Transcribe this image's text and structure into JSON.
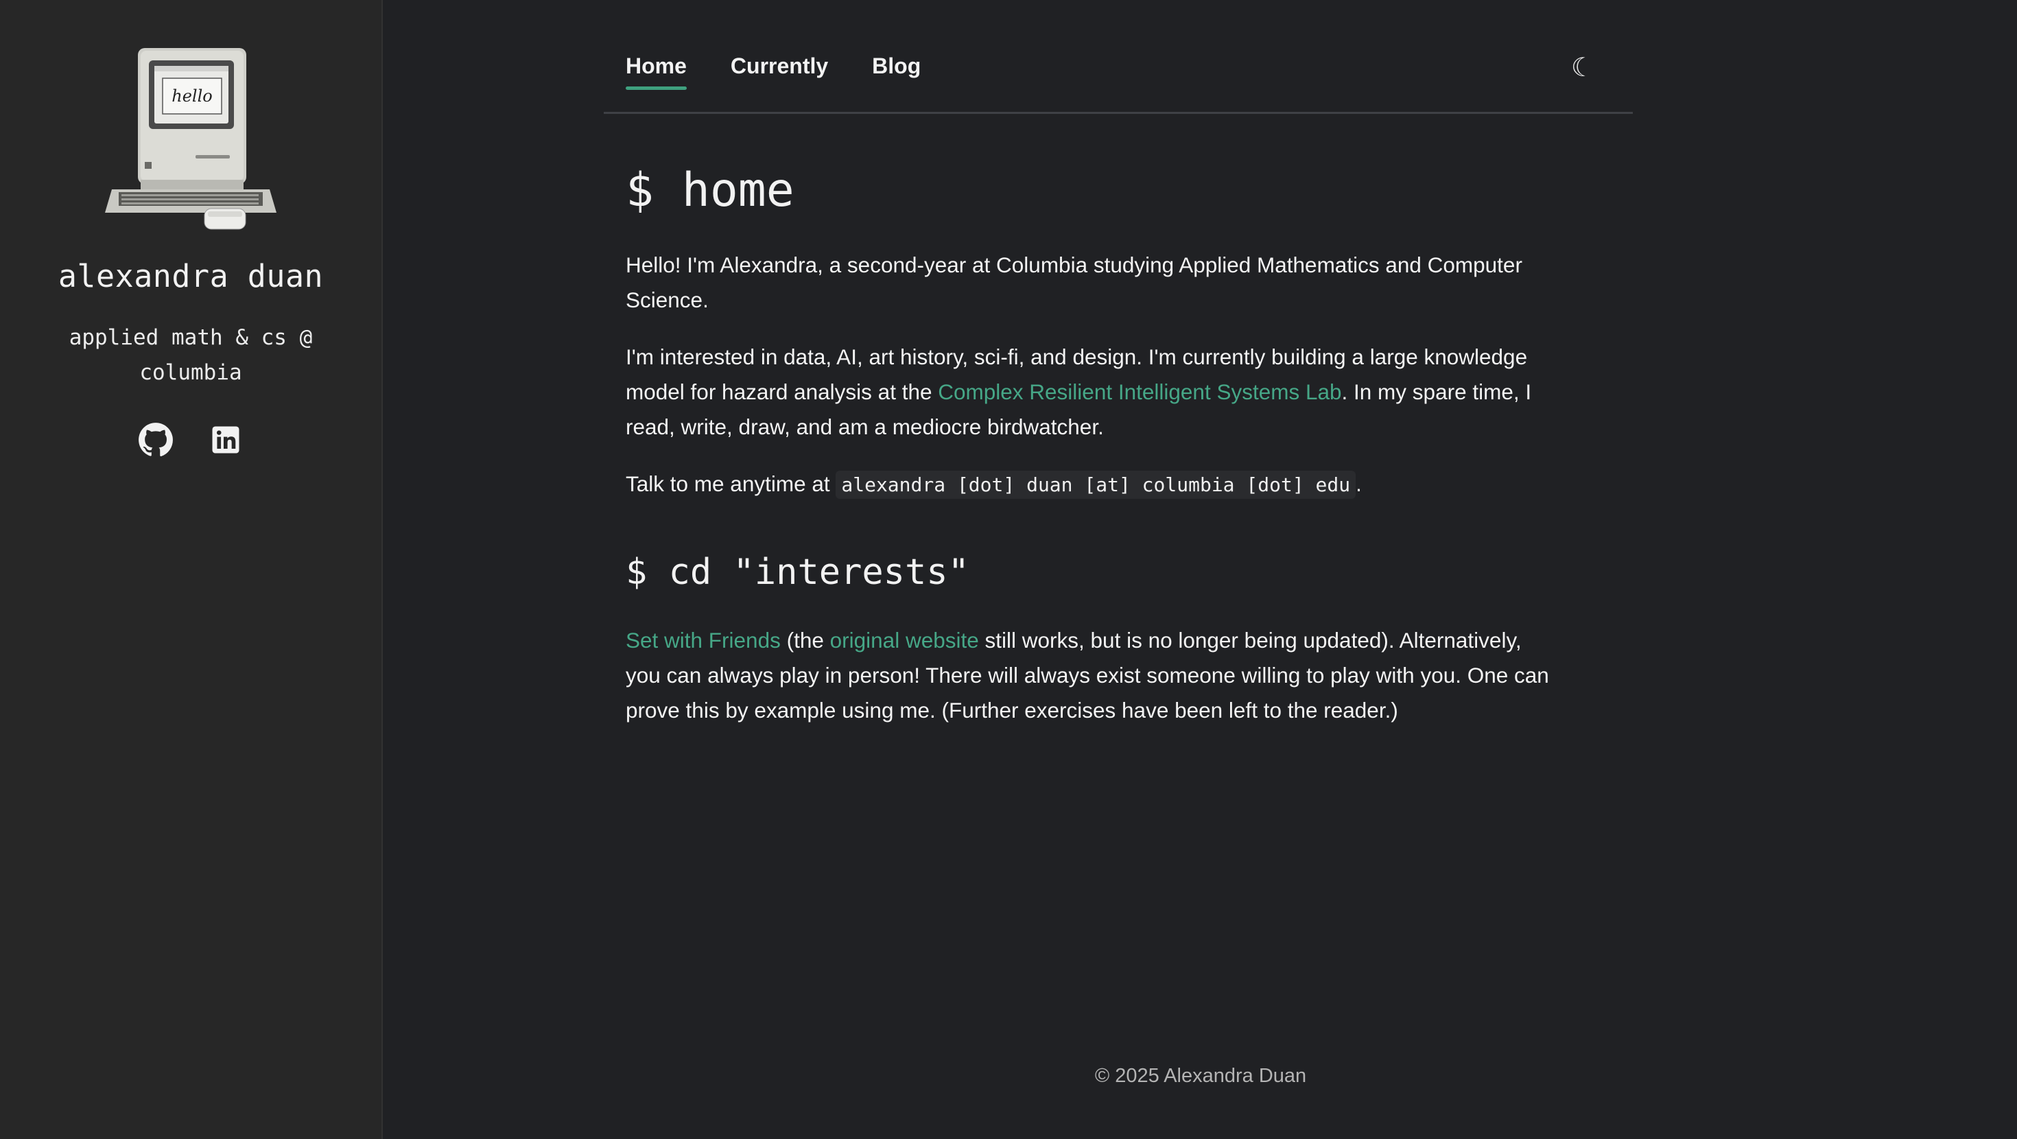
{
  "sidebar": {
    "name": "alexandra duan",
    "tagline": "applied math & cs @ columbia",
    "avatar_icon": "macintosh-computer",
    "avatar_screen_text": "hello",
    "social": [
      {
        "icon": "github-icon",
        "label": "GitHub"
      },
      {
        "icon": "linkedin-icon",
        "label": "LinkedIn"
      }
    ]
  },
  "nav": {
    "items": [
      {
        "label": "Home",
        "active": true
      },
      {
        "label": "Currently",
        "active": false
      },
      {
        "label": "Blog",
        "active": false
      }
    ],
    "theme_toggle_icon": "moon-icon",
    "theme_toggle_glyph": "☾"
  },
  "home": {
    "title": "$ home",
    "intro": "Hello! I'm Alexandra, a second-year at Columbia studying Applied Mathematics and Computer Science.",
    "interests_before": "I'm interested in data, AI, art history, sci-fi, and design. I'm currently building a large knowledge model for hazard analysis at the ",
    "lab_link": "Complex Resilient Intelligent Systems Lab",
    "interests_after": ". In my spare time, I read, write, draw, and am a mediocre birdwatcher.",
    "contact_prefix": "Talk to me anytime at ",
    "email": "alexandra [dot] duan [at] columbia [dot] edu",
    "contact_suffix": "."
  },
  "interests": {
    "title": "$ cd \"interests\"",
    "set_link": "Set with Friends",
    "text_a": " (the ",
    "original_link": "original website",
    "text_b": " still works, but is no longer being updated). Alternatively, you can always play in person! There will always exist someone willing to play with you. One can prove this by example using me. (Further exercises have been left to the reader.)"
  },
  "footer": {
    "text": "© 2025 Alexandra Duan"
  },
  "colors": {
    "background": "#202124",
    "sidebar": "#272727",
    "accent": "#46a787",
    "text": "#f4f4f4"
  }
}
